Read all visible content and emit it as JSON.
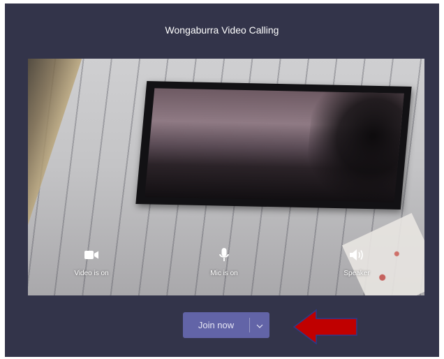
{
  "window": {
    "title": "Wongaburra Video Calling"
  },
  "controls": {
    "video": {
      "label": "Video is on",
      "icon": "video-camera-icon"
    },
    "mic": {
      "label": "Mic is on",
      "icon": "microphone-icon"
    },
    "speaker": {
      "label": "Speaker",
      "icon": "speaker-icon"
    }
  },
  "join": {
    "label": "Join now",
    "dropdown_icon": "chevron-down-icon"
  },
  "annotation": {
    "icon": "red-arrow-icon",
    "color": "#c00000"
  },
  "colors": {
    "background": "#33344a",
    "button": "#6264a7"
  }
}
